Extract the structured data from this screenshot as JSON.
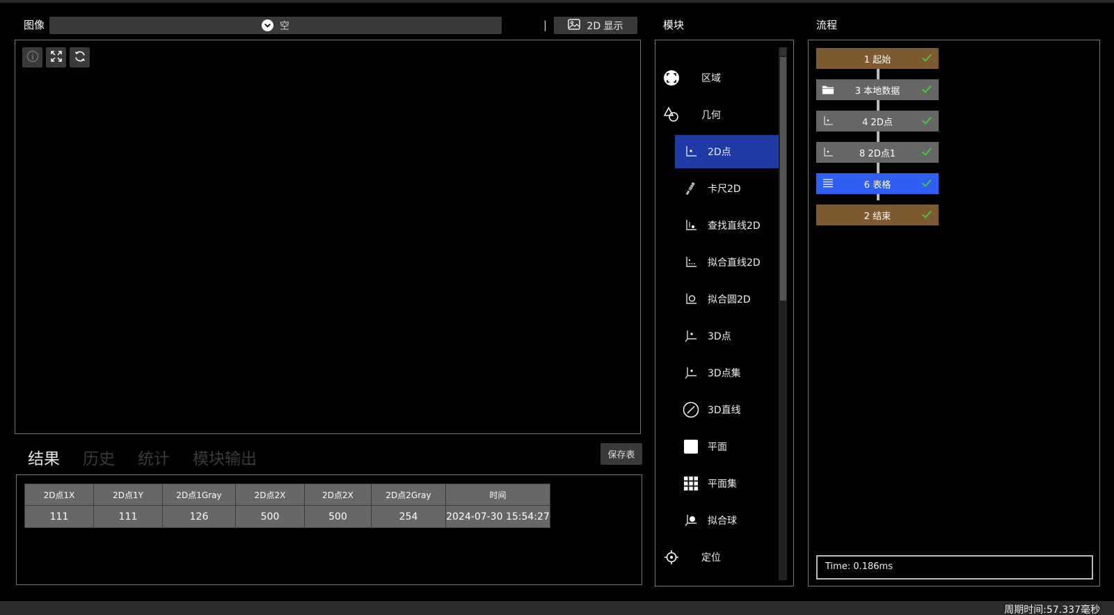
{
  "image": {
    "label": "图像",
    "select_value": "空",
    "separator": "|",
    "display_button": "2D 显示"
  },
  "tabs": [
    {
      "label": "结果",
      "active": true
    },
    {
      "label": "历史",
      "active": false
    },
    {
      "label": "统计",
      "active": false
    },
    {
      "label": "模块输出",
      "active": false
    }
  ],
  "save_button": "保存表",
  "result_table": {
    "columns": [
      "2D点1X",
      "2D点1Y",
      "2D点1Gray",
      "2D点2X",
      "2D点2X",
      "2D点2Gray",
      "时间"
    ],
    "rows": [
      [
        "111",
        "111",
        "126",
        "500",
        "500",
        "254",
        "2024-07-30 15:54:27"
      ]
    ]
  },
  "module": {
    "label": "模块",
    "items": [
      {
        "label": "区域",
        "icon": "region-icon"
      },
      {
        "label": "几何",
        "icon": "geometry-icon"
      },
      {
        "label": "2D点",
        "icon": "point-2d-icon",
        "selected": true
      },
      {
        "label": "卡尺2D",
        "icon": "caliper-icon"
      },
      {
        "label": "查找直线2D",
        "icon": "find-line-icon"
      },
      {
        "label": "拟合直线2D",
        "icon": "fit-line-icon"
      },
      {
        "label": "拟合圆2D",
        "icon": "fit-circle-icon"
      },
      {
        "label": "3D点",
        "icon": "point-3d-icon"
      },
      {
        "label": "3D点集",
        "icon": "point-set-3d-icon"
      },
      {
        "label": "3D直线",
        "icon": "line-3d-icon"
      },
      {
        "label": "平面",
        "icon": "plane-icon"
      },
      {
        "label": "平面集",
        "icon": "plane-set-icon"
      },
      {
        "label": "拟合球",
        "icon": "fit-sphere-icon"
      },
      {
        "label": "定位",
        "icon": "locate-icon"
      }
    ]
  },
  "flow": {
    "label": "流程",
    "nodes": [
      {
        "label": "1 起始",
        "style": "brown",
        "icon": ""
      },
      {
        "label": "3 本地数据",
        "style": "gray",
        "icon": "folder-icon"
      },
      {
        "label": "4 2D点",
        "style": "gray",
        "icon": "point-2d-icon"
      },
      {
        "label": "8 2D点1",
        "style": "gray",
        "icon": "point-2d-icon"
      },
      {
        "label": "6 表格",
        "style": "blue",
        "icon": "table-icon"
      },
      {
        "label": "2 结束",
        "style": "brown",
        "icon": ""
      }
    ],
    "time": "Time: 0.186ms"
  },
  "status": {
    "cycle_time": "周期时间:57.337毫秒"
  },
  "colors": {
    "selected_module": "#1f3aa5",
    "node_brown": "#7d5a2f",
    "node_gray": "#666666",
    "node_blue": "#2f5ff5",
    "check_green": "#3fd43f"
  }
}
